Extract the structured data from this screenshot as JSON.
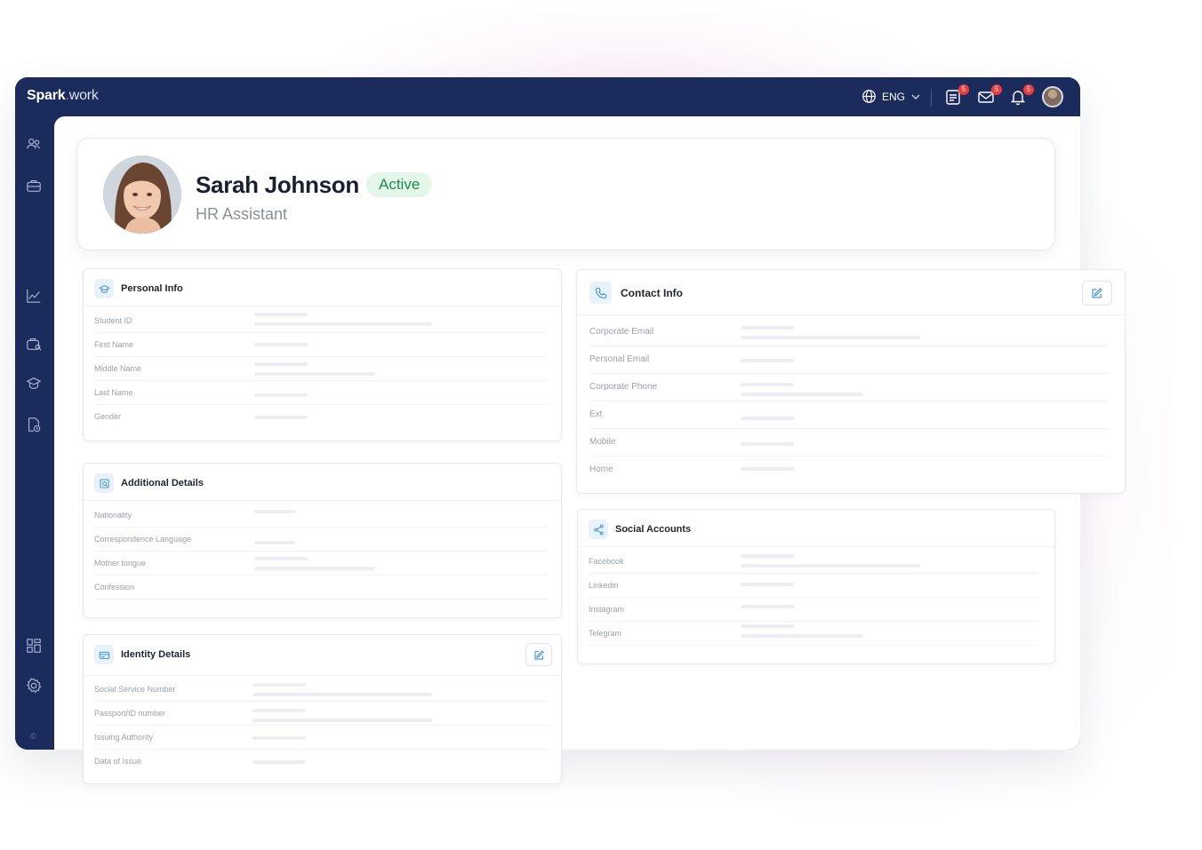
{
  "app": {
    "logo_main": "Spark",
    "logo_dot": ".",
    "logo_suffix": "work",
    "language": "ENG",
    "badges": {
      "tasks": "5",
      "messages": "5",
      "notifications": "5"
    },
    "copyright": "©"
  },
  "profile": {
    "name": "Sarah Johnson",
    "status": "Active",
    "role": "HR Assistant"
  },
  "personal_info": {
    "title": "Personal Info",
    "fields": [
      "Student ID",
      "First Name",
      "Middle Name",
      "Last Name",
      "Gender"
    ]
  },
  "additional_details": {
    "title": "Additional Details",
    "fields": [
      "Nationality",
      "Correspondence Language",
      "Mother tongue",
      "Confession"
    ]
  },
  "identity_details": {
    "title": "Identity Details",
    "fields": [
      "Social Service Number",
      "Passport/ID number",
      "Issuing Authority",
      "Data of Issue"
    ]
  },
  "contact_info": {
    "title": "Contact Info",
    "fields": [
      "Corporate Email",
      "Personal Email",
      "Corporate Phone",
      "Ext",
      "Mobile",
      "Home"
    ]
  },
  "social_accounts": {
    "title": "Social Accounts",
    "fields": [
      "Facebook",
      "Linkedin",
      "Instagram",
      "Telegram"
    ]
  },
  "colors": {
    "navy": "#1a2b5c",
    "active_bg": "#e4f6e9",
    "active_text": "#1f8a4a",
    "badge": "#ef3b3b",
    "icon_accent": "#3b8fd9"
  }
}
